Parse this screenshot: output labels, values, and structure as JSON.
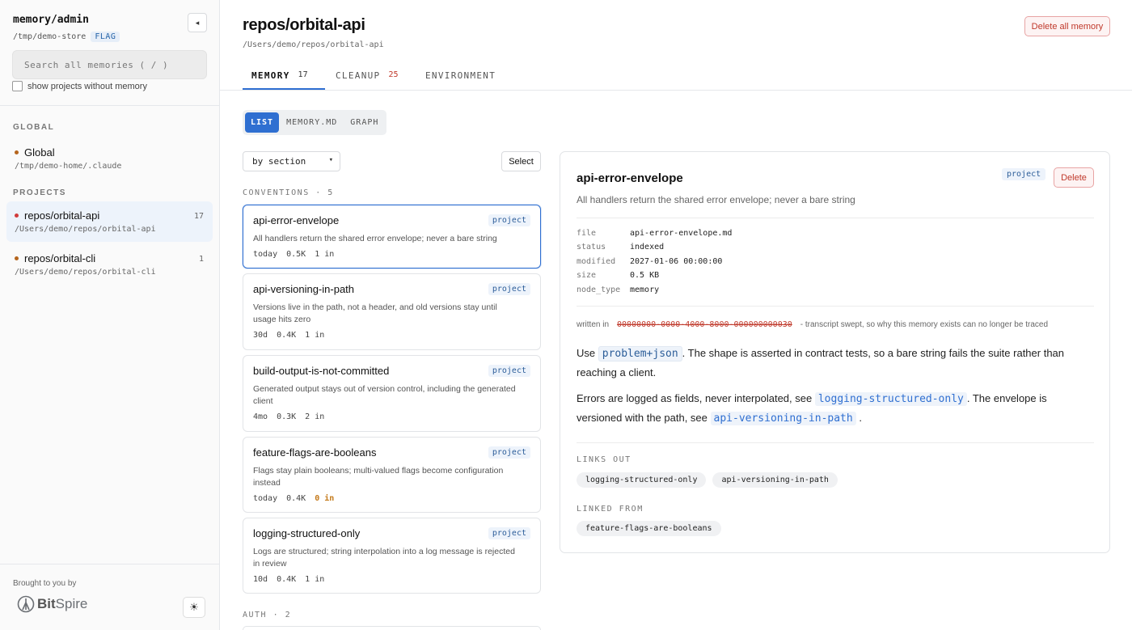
{
  "sidebar": {
    "brand": "memory/admin",
    "store_path": "/tmp/demo-store",
    "flag": "FLAG",
    "collapse_icon": "◂",
    "search_placeholder": "Search all memories  ( / )",
    "show_projects_label": "show projects without memory",
    "global_heading": "GLOBAL",
    "global_item": {
      "name": "Global",
      "path": "/tmp/demo-home/.claude",
      "dot_color": "#b5651d"
    },
    "projects_heading": "PROJECTS",
    "projects": [
      {
        "name": "repos/orbital-api",
        "path": "/Users/demo/repos/orbital-api",
        "count": "17",
        "dot_color": "#d03b3b"
      },
      {
        "name": "repos/orbital-cli",
        "path": "/Users/demo/repos/orbital-cli",
        "count": "1",
        "dot_color": "#b5651d"
      }
    ],
    "brought_by": "Brought to you by",
    "logo_bold": "Bit",
    "logo_rest": "Spire",
    "theme_icon": "☀"
  },
  "header": {
    "title": "repos/orbital-api",
    "path": "/Users/demo/repos/orbital-api",
    "delete_all_label": "Delete all memory"
  },
  "tabs": [
    {
      "label": "MEMORY",
      "count": "17",
      "count_color": "#333"
    },
    {
      "label": "CLEANUP",
      "count": "25",
      "count_color": "#c0392b"
    },
    {
      "label": "ENVIRONMENT",
      "count": ""
    }
  ],
  "view_modes": [
    "LIST",
    "MEMORY.MD",
    "GRAPH"
  ],
  "sort_value": "by section",
  "sort_chevron": "▾",
  "select_label": "Select",
  "sections": [
    {
      "heading": "CONVENTIONS · 5"
    },
    {
      "heading": "AUTH · 2"
    }
  ],
  "cards": [
    {
      "title": "api-error-envelope",
      "desc": "All handlers return the shared error envelope; never a bare string",
      "age": "today",
      "size": "0.5K",
      "links_in": "1 in",
      "tag": "project"
    },
    {
      "title": "api-versioning-in-path",
      "desc": "Versions live in the path, not a header, and old versions stay until usage hits zero",
      "age": "30d",
      "size": "0.4K",
      "links_in": "1 in",
      "tag": "project"
    },
    {
      "title": "build-output-is-not-committed",
      "desc": "Generated output stays out of version control, including the generated client",
      "age": "4mo",
      "size": "0.3K",
      "links_in": "2 in",
      "tag": "project"
    },
    {
      "title": "feature-flags-are-booleans",
      "desc": "Flags stay plain booleans; multi-valued flags become configuration instead",
      "age": "today",
      "size": "0.4K",
      "links_in": "0 in",
      "tag": "project"
    },
    {
      "title": "logging-structured-only",
      "desc": "Logs are structured; string interpolation into a log message is rejected in review",
      "age": "10d",
      "size": "0.4K",
      "links_in": "1 in",
      "tag": "project"
    }
  ],
  "detail": {
    "title": "api-error-envelope",
    "desc": "All handlers return the shared error envelope; never a bare string",
    "tag": "project",
    "delete_label": "Delete",
    "meta": [
      {
        "key": "file",
        "value": "api-error-envelope.md"
      },
      {
        "key": "status",
        "value": "indexed"
      },
      {
        "key": "modified",
        "value": "2027-01-06 00:00:00"
      },
      {
        "key": "size",
        "value": "0.5 KB"
      },
      {
        "key": "node_type",
        "value": "memory"
      }
    ],
    "written_in_label": "written in",
    "transcript_id": "00000000-0000-4000-8000-000000000030",
    "transcript_note": "- transcript swept, so why this memory exists can no longer be traced",
    "p1_a": "Use",
    "p1_code": "problem+json",
    "p1_b": ". The shape is asserted in contract tests, so a bare string fails the suite rather than reaching a client.",
    "p2_a": "Errors are logged as fields, never interpolated, see",
    "p2_link1": "logging-structured-only",
    "p2_b": ". The envelope is versioned with the path, see",
    "p2_link2": "api-versioning-in-path",
    "p2_c": ".",
    "links_out_heading": "LINKS OUT",
    "links_out": [
      "logging-structured-only",
      "api-versioning-in-path"
    ],
    "linked_from_heading": "LINKED FROM",
    "linked_from": [
      "feature-flags-are-booleans"
    ]
  },
  "colors": {
    "accent": "#2f6fd1",
    "danger": "#c0392b",
    "warn": "#c47a1b"
  }
}
